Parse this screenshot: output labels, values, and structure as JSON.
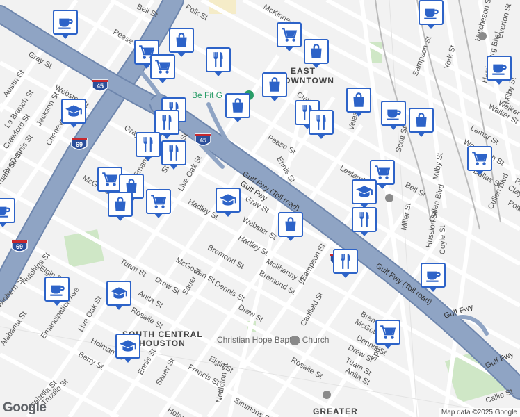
{
  "areas": [
    {
      "id": "east",
      "lines": [
        "EAST",
        "TOWNTOWN"
      ]
    },
    {
      "id": "south",
      "lines": [
        "SOUTH CENTRAL",
        "HOUSTON"
      ]
    },
    {
      "id": "greater",
      "lines": [
        "GREATER"
      ]
    }
  ],
  "highways": [
    "45",
    "45",
    "45",
    "69",
    "69",
    "288"
  ],
  "freeway_labels": [
    "Gulf Fwy (Toll road)",
    "Gulf Fwy",
    "Gulf Fwy (Toll road)",
    "Gulf Fwy",
    "Gulf Fwy"
  ],
  "streets": [
    "Bell St",
    "Polk St",
    "McKinney St",
    "Pease St",
    "Gray St",
    "Webster St",
    "Austin St",
    "Jackson St",
    "Chenevert St",
    "La Branch St",
    "Crawford St",
    "Dennis St",
    "Drew St",
    "Tuam St",
    "McGowen St",
    "Gray St",
    "Emancipation Ave",
    "St Charles St",
    "Live Oak St",
    "Hadley St",
    "Gray St",
    "Webster St",
    "Hadley St",
    "Bremond St",
    "McIlhenny St",
    "Bremond St",
    "Sampson St",
    "McGowen St",
    "Dennis St",
    "Drew St",
    "Sauer St",
    "Tuam St",
    "Drew St",
    "Anita St",
    "Rosalie St",
    "Hutchins St",
    "Emancipation Ave",
    "Winbern St",
    "Alabama St",
    "Live Oak St",
    "Holman St",
    "Berry St",
    "Ennis St",
    "Sauer St",
    "Francis St",
    "Elgin St",
    "Elgin St",
    "Nettleton St",
    "Simmons St",
    "Truxillo St",
    "Isabella St",
    "Holman St",
    "Rosalie St",
    "Canfield St",
    "Anita St",
    "Tuam St",
    "Drew St",
    "Dennis St",
    "McGowen St",
    "Bremond St",
    "Coyle St",
    "Hussion St",
    "Miller St",
    "Milby St",
    "Bell St",
    "Leeland St",
    "Pease St",
    "Ennis St",
    "Velasco St",
    "Scott St",
    "Dallas St",
    "Walker St",
    "Lamar St",
    "Woodleigh St",
    "Clay St",
    "Cullen Blvd",
    "Cullen Blvd",
    "Sampson St",
    "York St",
    "Hutcheson St",
    "Everton St",
    "Harrisburg Blvd",
    "Milby St",
    "Callie St",
    "Spur 5",
    "Clay St",
    "Polk St",
    "Walker St",
    "Po"
  ],
  "pois": [
    {
      "id": "befit",
      "label": "Be Fit G"
    },
    {
      "id": "church",
      "label": "Christian Hope Baptist Church"
    }
  ],
  "markers": [
    {
      "type": "cafe",
      "icon": "coffee-cup-icon"
    },
    {
      "type": "cafe",
      "icon": "coffee-cup-icon"
    },
    {
      "type": "shop",
      "icon": "shopping-bag-icon"
    },
    {
      "type": "grocery",
      "icon": "shopping-cart-icon"
    },
    {
      "type": "grocery",
      "icon": "shopping-cart-icon"
    },
    {
      "type": "restaurant",
      "icon": "fork-knife-icon"
    },
    {
      "type": "grocery",
      "icon": "shopping-cart-icon"
    },
    {
      "type": "shop",
      "icon": "shopping-bag-icon"
    },
    {
      "type": "shop",
      "icon": "shopping-bag-icon"
    },
    {
      "type": "school",
      "icon": "graduation-cap-icon"
    },
    {
      "type": "restaurant",
      "icon": "fork-knife-icon"
    },
    {
      "type": "restaurant",
      "icon": "fork-knife-icon"
    },
    {
      "type": "shop",
      "icon": "shopping-bag-icon"
    },
    {
      "type": "restaurant",
      "icon": "fork-knife-icon"
    },
    {
      "type": "restaurant",
      "icon": "fork-knife-icon"
    },
    {
      "type": "shop",
      "icon": "shopping-bag-icon"
    },
    {
      "type": "cafe",
      "icon": "coffee-cup-icon"
    },
    {
      "type": "shop",
      "icon": "shopping-bag-icon"
    },
    {
      "type": "restaurant",
      "icon": "fork-knife-icon"
    },
    {
      "type": "restaurant",
      "icon": "fork-knife-icon"
    },
    {
      "type": "grocery",
      "icon": "shopping-cart-icon"
    },
    {
      "type": "shop",
      "icon": "shopping-bag-icon"
    },
    {
      "type": "shop",
      "icon": "shopping-bag-icon"
    },
    {
      "type": "grocery",
      "icon": "shopping-cart-icon"
    },
    {
      "type": "school",
      "icon": "graduation-cap-icon"
    },
    {
      "type": "shop",
      "icon": "shopping-bag-icon"
    },
    {
      "type": "grocery",
      "icon": "shopping-cart-icon"
    },
    {
      "type": "school",
      "icon": "graduation-cap-icon"
    },
    {
      "type": "restaurant",
      "icon": "fork-knife-icon"
    },
    {
      "type": "restaurant",
      "icon": "fork-knife-icon"
    },
    {
      "type": "cafe",
      "icon": "coffee-cup-icon"
    },
    {
      "type": "cafe",
      "icon": "coffee-cup-icon"
    },
    {
      "type": "school",
      "icon": "graduation-cap-icon"
    },
    {
      "type": "grocery",
      "icon": "shopping-cart-icon"
    },
    {
      "type": "school",
      "icon": "graduation-cap-icon"
    },
    {
      "type": "grocery",
      "icon": "shopping-cart-icon"
    },
    {
      "type": "cafe",
      "icon": "coffee-cup-icon"
    },
    {
      "type": "school",
      "icon": "graduation-cap-icon"
    },
    {
      "type": "cafe",
      "icon": "coffee-cup-icon"
    },
    {
      "type": "shop",
      "icon": "shopping-bag-icon"
    }
  ],
  "branding": {
    "logo": "Google",
    "attribution": "Map data ©2025 Google"
  },
  "colors": {
    "freeway": "#8fa4c4",
    "freeway_edge": "#6e86ad",
    "street": "#ffffff",
    "park": "#cfe7c6",
    "marker_border": "#2d63c8",
    "background": "#f2f2f2"
  }
}
